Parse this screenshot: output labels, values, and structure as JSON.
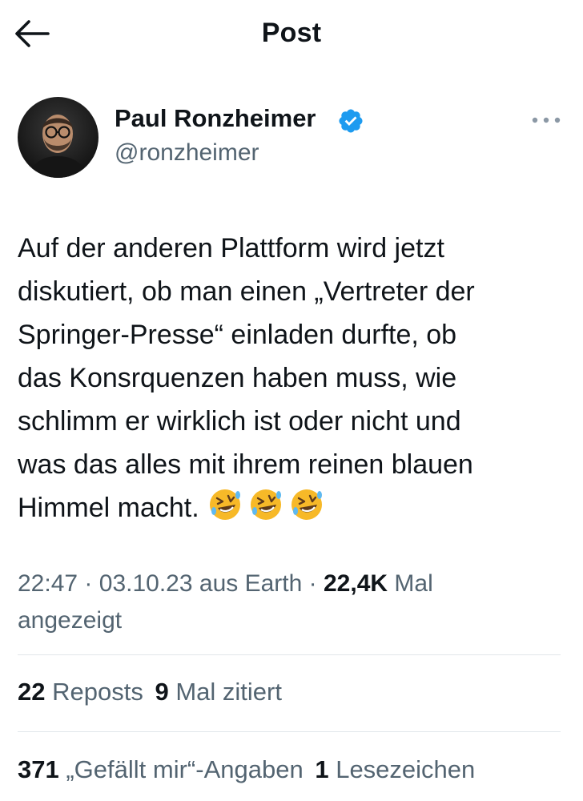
{
  "header": {
    "title": "Post",
    "back_icon": "arrow-left-icon"
  },
  "author": {
    "name": "Paul Ronzheimer",
    "handle": "@ronzheimer",
    "verified_icon": "verified-badge-icon",
    "verified_color": "#1d9bf0",
    "more_icon": "more-horizontal-icon"
  },
  "tweet": {
    "lines": [
      "Auf der anderen Plattform wird jetzt",
      "diskutiert, ob man einen „Vertreter der",
      "Springer-Presse“ einladen durfte, ob",
      "das Konsrquenzen haben muss, wie",
      "schlimm er wirklich ist oder nicht und",
      "was das alles mit ihrem reinen blauen",
      "Himmel macht."
    ],
    "emoji": [
      "🤣",
      "🤣",
      "🤣"
    ]
  },
  "meta": {
    "time": "22:47",
    "date": "03.10.23",
    "location": "aus Earth",
    "views_count": "22,4K",
    "views_label_1": "Mal",
    "views_label_2": "angezeigt"
  },
  "stats": {
    "reposts_count": "22",
    "reposts_label": "Reposts",
    "quotes_count": "9",
    "quotes_label": "Mal zitiert",
    "likes_count": "371",
    "likes_label": "„Gefällt mir“-Angaben",
    "bookmarks_count": "1",
    "bookmarks_label": "Lesezeichen"
  },
  "colors": {
    "text": "#0f1419",
    "secondary": "#536471",
    "divider": "#e1e6ea",
    "accent": "#1d9bf0"
  }
}
